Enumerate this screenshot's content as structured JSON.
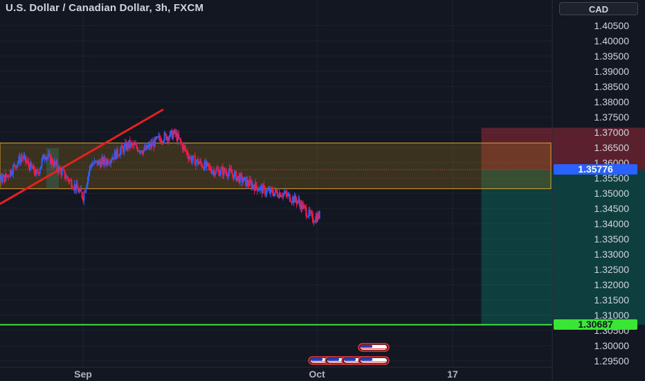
{
  "header": {
    "title": "U.S. Dollar / Canadian Dollar, 3h, FXCM",
    "currency_button": "CAD"
  },
  "price_axis": {
    "ticks": [
      "1.40500",
      "1.40000",
      "1.39500",
      "1.39000",
      "1.38500",
      "1.38000",
      "1.37500",
      "1.37000",
      "1.36500",
      "1.36000",
      "1.35500",
      "1.35000",
      "1.34500",
      "1.34000",
      "1.33500",
      "1.33000",
      "1.32500",
      "1.32000",
      "1.31500",
      "1.31000",
      "1.30500",
      "1.30000",
      "1.29500"
    ]
  },
  "time_axis": {
    "labels": [
      "Sep",
      "Oct",
      "17"
    ]
  },
  "current_price": {
    "value": "1.35776",
    "color": "#2962ff"
  },
  "horizontal_line": {
    "value": "1.30687",
    "color": "#39e636"
  },
  "colors": {
    "background": "#131722",
    "up_candle": "#2962ff",
    "down_candle": "#ff1744",
    "trendline": "#e8211f",
    "zone_fill": "#a07a18",
    "stop_fill": "#f23645",
    "target_fill": "#089981"
  },
  "chart_data": {
    "type": "candlestick",
    "symbol": "U.S. Dollar / Canadian Dollar",
    "interval": "3h",
    "source": "FXCM",
    "ylim": [
      1.292,
      1.4115
    ],
    "xlim_dates": [
      "2023-08-17",
      "2023-11-01"
    ],
    "price_path": [
      [
        "2023-08-17",
        1.3585
      ],
      [
        "2023-08-19",
        1.3515
      ],
      [
        "2023-08-22",
        1.3555
      ],
      [
        "2023-08-24",
        1.362
      ],
      [
        "2023-08-26",
        1.356
      ],
      [
        "2023-08-27",
        1.363
      ],
      [
        "2023-08-29",
        1.3575
      ],
      [
        "2023-08-31",
        1.352
      ],
      [
        "2023-09-01",
        1.349
      ],
      [
        "2023-09-02",
        1.3595
      ],
      [
        "2023-09-04",
        1.3605
      ],
      [
        "2023-09-07",
        1.366
      ],
      [
        "2023-09-09",
        1.364
      ],
      [
        "2023-09-11",
        1.368
      ],
      [
        "2023-09-13",
        1.3695
      ],
      [
        "2023-09-15",
        1.3615
      ],
      [
        "2023-09-18",
        1.3575
      ],
      [
        "2023-09-20",
        1.357
      ],
      [
        "2023-09-22",
        1.354
      ],
      [
        "2023-09-25",
        1.3505
      ],
      [
        "2023-09-27",
        1.35
      ],
      [
        "2023-09-29",
        1.3475
      ],
      [
        "2023-10-01",
        1.3415
      ],
      [
        "2023-10-02",
        1.343
      ],
      [
        "2023-10-04",
        1.3485
      ],
      [
        "2023-10-05",
        1.346
      ],
      [
        "2023-10-08",
        1.3505
      ],
      [
        "2023-10-10",
        1.347
      ],
      [
        "2023-10-12",
        1.3515
      ],
      [
        "2023-10-14",
        1.3535
      ],
      [
        "2023-10-17",
        1.351
      ],
      [
        "2023-10-19",
        1.3485
      ],
      [
        "2023-10-20",
        1.342
      ],
      [
        "2023-10-21",
        1.358
      ]
    ],
    "annotations": {
      "trendline": [
        [
          "2023-08-17",
          1.3465
        ],
        [
          "2023-09-23",
          1.3775
        ]
      ],
      "resistance_zone": {
        "top": 1.3665,
        "bottom": 1.3515,
        "start": "2023-08-17",
        "end": "2023-12-10"
      },
      "short_position": {
        "entry": 1.35776,
        "stop": 1.3715,
        "target": 1.30687,
        "start": "2023-10-23",
        "end": "2023-11-17"
      },
      "horizontal_level": 1.30687
    }
  }
}
